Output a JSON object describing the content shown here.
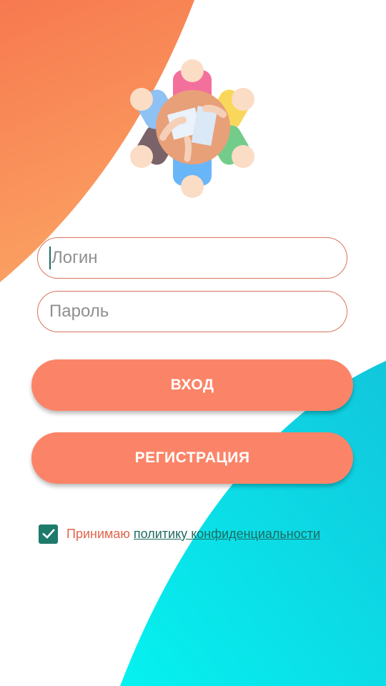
{
  "form": {
    "login_placeholder": "Логин",
    "password_placeholder": "Пароль",
    "login_button": "ВХОД",
    "register_button": "РЕГИСТРАЦИЯ"
  },
  "consent": {
    "checked": true,
    "text": "Принимаю",
    "link_text": "политику конфиденциальности"
  },
  "icons": {
    "logo": "people-meeting-table-icon",
    "checkbox": "checkmark-icon"
  },
  "colors": {
    "accent": "#fb8468",
    "field_border": "#d9735f",
    "consent_text": "#e0654b",
    "checkbox": "#1e7a6b",
    "link": "#1e6b60",
    "orange_shape": "#f88658",
    "cyan_shape": "#0fd4e0"
  }
}
